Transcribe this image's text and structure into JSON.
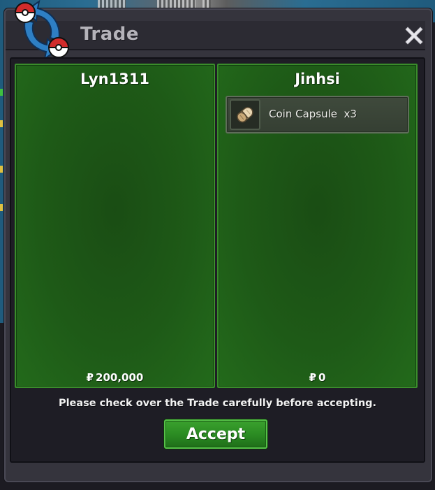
{
  "window": {
    "title": "Trade"
  },
  "icons": {
    "logo": "trade-arrows-pokeball-icon",
    "close": "close-icon",
    "item": "coin-capsule-icon"
  },
  "trade": {
    "left_panel": {
      "player_name": "Lyn1311",
      "currency_symbol": "₽",
      "money": "200,000",
      "items": []
    },
    "right_panel": {
      "player_name": "Jinhsi",
      "currency_symbol": "₽",
      "money": "0",
      "items": [
        {
          "label": "Coin Capsule  x3",
          "icon": "coin-capsule-icon"
        }
      ]
    }
  },
  "notice": "Please check over the Trade carefully before accepting.",
  "buttons": {
    "accept": "Accept"
  },
  "colors": {
    "panel_green": "#1e5a17",
    "panel_border": "#3a8d2b",
    "accept_green": "#2a8a22",
    "window_bg": "#35343d",
    "logo_blue": "#2e7fc4",
    "logo_red": "#d12b2b"
  }
}
